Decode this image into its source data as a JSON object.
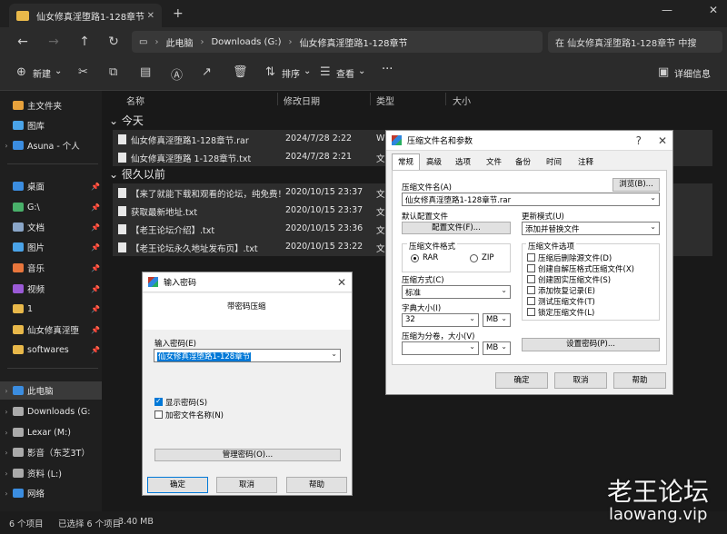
{
  "tab": {
    "title": "仙女修真淫堕路1-128章节"
  },
  "nav": {
    "breadcrumb": [
      "此电脑",
      "Downloads (G:)",
      "仙女修真淫堕路1-128章节"
    ],
    "search_placeholder": "在 仙女修真淫堕路1-128章节 中搜"
  },
  "toolbar": {
    "new": "新建",
    "sort": "排序",
    "view": "查看",
    "details": "详细信息"
  },
  "sidebar": {
    "items": [
      {
        "label": "主文件夹",
        "icon": "home-icon",
        "color": "#e8a23c"
      },
      {
        "label": "图库",
        "icon": "gallery-icon",
        "color": "#4aa3e8"
      },
      {
        "label": "Asuna - 个人",
        "icon": "cloud-icon",
        "color": "#3b8de0"
      },
      {
        "label": "桌面",
        "icon": "desktop-icon",
        "color": "#3b8de0"
      },
      {
        "label": "G:\\",
        "icon": "download-icon",
        "color": "#49b06a"
      },
      {
        "label": "文档",
        "icon": "document-icon",
        "color": "#8aa6c8"
      },
      {
        "label": "图片",
        "icon": "picture-icon",
        "color": "#4aa3e8"
      },
      {
        "label": "音乐",
        "icon": "music-icon",
        "color": "#e8763c"
      },
      {
        "label": "视频",
        "icon": "video-icon",
        "color": "#9a5ad6"
      },
      {
        "label": "1",
        "icon": "folder-icon",
        "color": "#e8b84a"
      },
      {
        "label": "仙女修真淫堕",
        "icon": "folder-icon",
        "color": "#e8b84a"
      },
      {
        "label": "softwares",
        "icon": "folder-icon",
        "color": "#e8b84a"
      },
      {
        "label": "此电脑",
        "icon": "pc-icon",
        "color": "#3b8de0"
      },
      {
        "label": "Downloads (G:",
        "icon": "drive-icon",
        "color": "#aaaaaa"
      },
      {
        "label": "Lexar (M:)",
        "icon": "drive-icon",
        "color": "#aaaaaa"
      },
      {
        "label": "影音（东芝3T）",
        "icon": "drive-icon",
        "color": "#aaaaaa"
      },
      {
        "label": "资料 (L:)",
        "icon": "drive-icon",
        "color": "#aaaaaa"
      },
      {
        "label": "网络",
        "icon": "network-icon",
        "color": "#3b8de0"
      }
    ]
  },
  "columns": {
    "name": "名称",
    "date": "修改日期",
    "type": "类型",
    "size": "大小"
  },
  "groups": {
    "today": "今天",
    "long_ago": "很久以前"
  },
  "files_today": [
    {
      "name": "仙女修真淫堕路1-128章节.rar",
      "date": "2024/7/28 2:22",
      "type": "W"
    },
    {
      "name": "仙女修真淫堕路 1-128章节.txt",
      "date": "2024/7/28 2:21",
      "type": "文"
    }
  ],
  "files_old": [
    {
      "name": "【来了就能下载和观看的论坛，纯免费！",
      "date": "2020/10/15 23:37",
      "type": "文"
    },
    {
      "name": "获取最新地址.txt",
      "date": "2020/10/15 23:37",
      "type": "文"
    },
    {
      "name": "【老王论坛介绍】.txt",
      "date": "2020/10/15 23:36",
      "type": "文"
    },
    {
      "name": "【老王论坛永久地址发布页】.txt",
      "date": "2020/10/15 23:22",
      "type": "文"
    }
  ],
  "status": {
    "count": "6 个项目",
    "selected": "已选择 6 个项目",
    "size": "3.40 MB"
  },
  "archive_dialog": {
    "title": "压缩文件名和参数",
    "help": "?",
    "tabs": [
      "常规",
      "高级",
      "选项",
      "文件",
      "备份",
      "时间",
      "注释"
    ],
    "archive_name_label": "压缩文件名(A)",
    "browse": "浏览(B)...",
    "archive_name": "仙女修真淫堕路1-128章节.rar",
    "default_profile_label": "默认配置文件",
    "profiles": "配置文件(F)...",
    "update_mode_label": "更新模式(U)",
    "update_mode": "添加并替换文件",
    "format_label": "压缩文件格式",
    "fmt_rar": "RAR",
    "fmt_zip": "ZIP",
    "method_label": "压缩方式(C)",
    "method": "标准",
    "dict_label": "字典大小(I)",
    "dict": "32",
    "dict_unit": "MB",
    "split_label": "压缩为分卷，大小(V)",
    "split": "",
    "split_unit": "MB",
    "options_label": "压缩文件选项",
    "options": [
      "压缩后删除源文件(D)",
      "创建自解压格式压缩文件(X)",
      "创建固实压缩文件(S)",
      "添加恢复记录(E)",
      "测试压缩文件(T)",
      "锁定压缩文件(L)"
    ],
    "set_password": "设置密码(P)...",
    "ok": "确定",
    "cancel": "取消",
    "help_btn": "帮助"
  },
  "password_dialog": {
    "title": "输入密码",
    "heading": "带密码压缩",
    "enter_label": "输入密码(E)",
    "password_value": "仙女修真淫堕路1-128章节",
    "show_password": "显示密码(S)",
    "encrypt_names": "加密文件名称(N)",
    "manage": "管理密码(O)...",
    "ok": "确定",
    "cancel": "取消",
    "help": "帮助"
  },
  "watermark": {
    "cn": "老王论坛",
    "en": "laowang.vip"
  }
}
